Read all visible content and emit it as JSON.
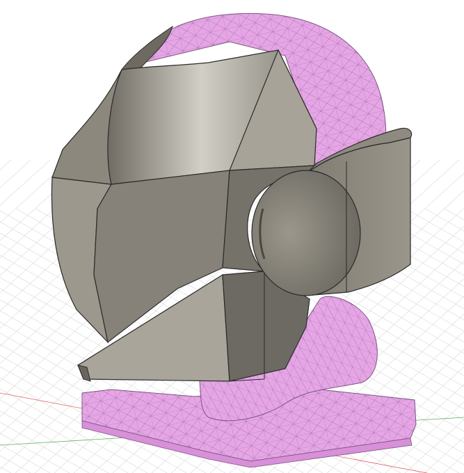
{
  "viewport": {
    "background": "#ffffff",
    "grid_color": "#d8d8d8",
    "axis_x_color": "#e06060",
    "axis_y_color": "#60b060"
  },
  "model": {
    "helmet_color": "#8f8b80",
    "helmet_dark": "#5f5c55",
    "helmet_light": "#c9c6bc",
    "mesh_color": "#e6a6e6",
    "mesh_line_color": "#9a6aa0",
    "edge_color": "#2a2a2a"
  }
}
